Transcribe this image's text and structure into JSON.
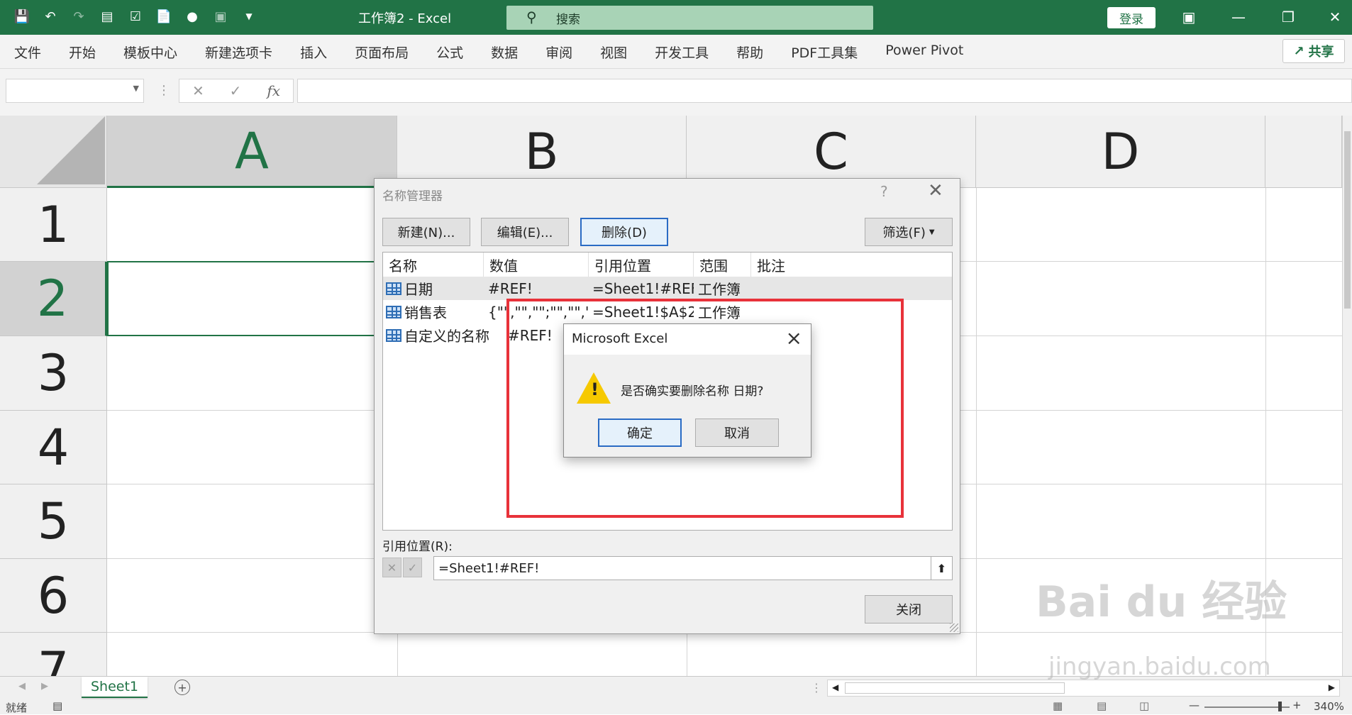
{
  "window": {
    "title": "工作簿2  -  Excel",
    "search_placeholder": "搜索",
    "login_label": "登录"
  },
  "ribbon": {
    "tabs": [
      "文件",
      "开始",
      "模板中心",
      "新建选项卡",
      "插入",
      "页面布局",
      "公式",
      "数据",
      "审阅",
      "视图",
      "开发工具",
      "帮助",
      "PDF工具集",
      "Power Pivot"
    ],
    "share_label": "共享"
  },
  "formula_bar": {
    "fx_label": "fx"
  },
  "sheet": {
    "columns": [
      "A",
      "B",
      "C",
      "D"
    ],
    "rows": [
      "1",
      "2",
      "3",
      "4",
      "5",
      "6",
      "7"
    ],
    "tab_name": "Sheet1",
    "status_text": "就绪",
    "zoom": "340%"
  },
  "name_manager": {
    "title": "名称管理器",
    "help": "?",
    "buttons": {
      "new": "新建(N)...",
      "edit": "编辑(E)...",
      "delete": "删除(D)",
      "filter": "筛选(F)",
      "close": "关闭"
    },
    "columns": [
      "名称",
      "数值",
      "引用位置",
      "范围",
      "批注"
    ],
    "rows": [
      {
        "name": "日期",
        "value": "#REF!",
        "ref": "=Sheet1!#REF!",
        "scope": "工作簿",
        "comment": ""
      },
      {
        "name": "销售表",
        "value": "{\"\",\"\",\"\";\"\",\"\",\"...",
        "ref": "=Sheet1!$A$2:...",
        "scope": "工作簿",
        "comment": ""
      },
      {
        "name": "自定义的名称",
        "value": "#REF!",
        "ref": "",
        "scope": "",
        "comment": ""
      }
    ],
    "ref_label": "引用位置(R):",
    "ref_value": "=Sheet1!#REF!"
  },
  "message_box": {
    "title": "Microsoft Excel",
    "message": "是否确实要删除名称 日期?",
    "ok_label": "确定",
    "cancel_label": "取消"
  },
  "watermark": {
    "line1": "Bai  du 经验",
    "line2": "jingyan.baidu.com"
  }
}
